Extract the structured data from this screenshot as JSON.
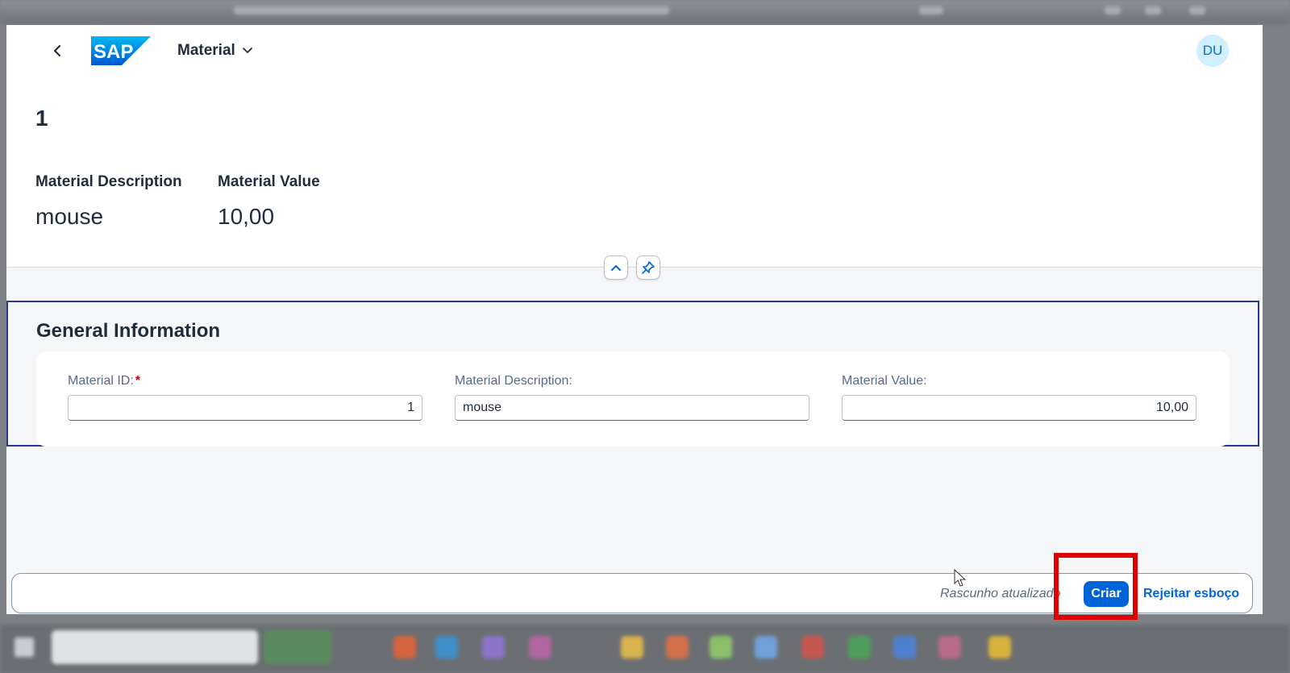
{
  "shellbar": {
    "back_icon": "chevron-left-icon",
    "logo_text": "SAP",
    "app_title": "Material",
    "menu_icon": "chevron-down-icon",
    "avatar_initials": "DU"
  },
  "header": {
    "object_title": "1",
    "key_facts": [
      {
        "label": "Material Description",
        "value": "mouse"
      },
      {
        "label": "Material Value",
        "value": "10,00"
      }
    ],
    "collapse_icon": "chevron-up-icon",
    "pin_icon": "pin-icon"
  },
  "section": {
    "title": "General Information",
    "fields": [
      {
        "label": "Material ID:",
        "required_mark": "*",
        "value": "1",
        "align": "right"
      },
      {
        "label": "Material Description:",
        "value": "mouse",
        "align": "left"
      },
      {
        "label": "Material Value:",
        "value": "10,00",
        "align": "right"
      }
    ]
  },
  "footer": {
    "draft_status": "Rascunho atualizado",
    "create_label": "Criar",
    "reject_label": "Rejeitar esboço"
  },
  "colors": {
    "brand_blue": "#0064d9",
    "section_border": "#2b3a91",
    "highlight": "#e00000",
    "required": "#aa0808"
  }
}
